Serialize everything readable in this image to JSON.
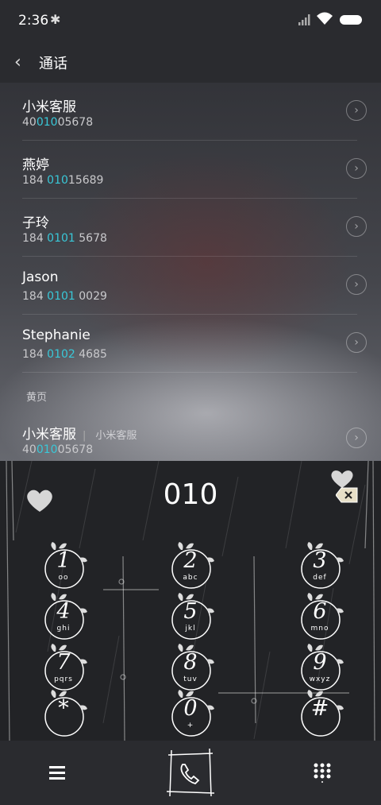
{
  "status": {
    "time": "2:36"
  },
  "header": {
    "title": "通话",
    "back_icon": "chevron-left-icon"
  },
  "results": [
    {
      "name": "小米客服",
      "num_pre": "40",
      "num_hl": "010",
      "num_post": "05678"
    },
    {
      "name": "燕婷",
      "num_pre": "184 ",
      "num_hl": "010",
      "num_post": "15689"
    },
    {
      "name": "子玲",
      "num_pre": "184 ",
      "num_hl": "0101",
      "num_post": " 5678"
    },
    {
      "name": "Jason",
      "num_pre": "184 ",
      "num_hl": "0101",
      "num_post": " 0029"
    },
    {
      "name": "Stephanie",
      "num_pre": "184 ",
      "num_hl": "0102",
      "num_post": " 4685"
    }
  ],
  "yellow_pages": {
    "section_label": "黄页",
    "name": "小米客服",
    "sub": "小米客服",
    "num_pre": "40",
    "num_hl": "010",
    "num_post": "05678"
  },
  "dialer": {
    "input": "010",
    "keys": [
      {
        "digit": "1",
        "letters": "oo"
      },
      {
        "digit": "2",
        "letters": "abc"
      },
      {
        "digit": "3",
        "letters": "def"
      },
      {
        "digit": "4",
        "letters": "ghi"
      },
      {
        "digit": "5",
        "letters": "jkl"
      },
      {
        "digit": "6",
        "letters": "mno"
      },
      {
        "digit": "7",
        "letters": "pqrs"
      },
      {
        "digit": "8",
        "letters": "tuv"
      },
      {
        "digit": "9",
        "letters": "wxyz"
      },
      {
        "digit": "*",
        "letters": ""
      },
      {
        "digit": "0",
        "letters": "+"
      },
      {
        "digit": "#",
        "letters": ""
      }
    ]
  },
  "colors": {
    "highlight": "#39c8d8",
    "bar": "#2a2b2f"
  }
}
